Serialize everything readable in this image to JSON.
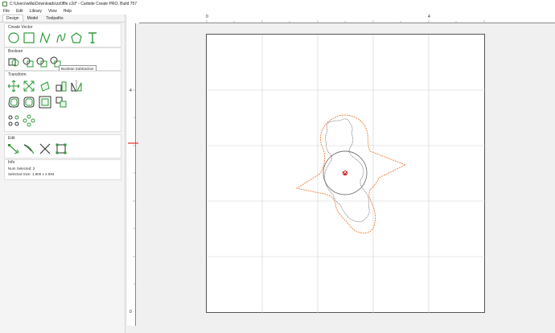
{
  "window": {
    "title": "C:\\Users\\willa\\Downloads\\zz0ffle.c2d* - Carbide Create PRO, Build 757"
  },
  "menu": [
    "File",
    "Edit",
    "Library",
    "View",
    "Help"
  ],
  "tabs": [
    "Design",
    "Model",
    "Toolpaths"
  ],
  "sections": {
    "create_vector": "Create Vector",
    "boolean": "Boolean",
    "transform": "Transform",
    "edit": "Edit",
    "info": "Info"
  },
  "tooltip": "Boolean Subtraction",
  "info": {
    "num_selected_label": "Num Selected:",
    "num_selected_value": "2",
    "selected_size_label": "Selected Size:",
    "selected_size_value": "1.900 x 2.094"
  },
  "rulers": {
    "top_labels": [
      "0",
      "4"
    ],
    "left_labels": [
      "4",
      "0"
    ]
  },
  "colors": {
    "tool_green": "#2e9a3a",
    "orange_path": "#ee7d3b",
    "gray_path": "#8a8a8a",
    "center_red": "#d62020",
    "ruler_marker": "#e53030"
  }
}
